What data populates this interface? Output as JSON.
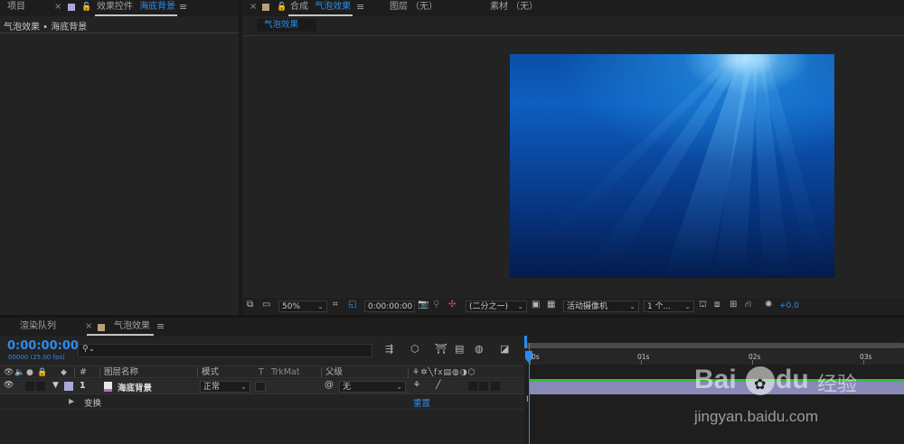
{
  "project_tab": {
    "label": "项目"
  },
  "effect_controls_tab": {
    "label": "效果控件",
    "layer": "海底背景"
  },
  "effect_controls": {
    "header": "气泡效果 • 海底背景"
  },
  "composition_tab": {
    "label": "合成",
    "name": "气泡效果"
  },
  "layer_tab": {
    "label": "图层 （无）"
  },
  "footage_tab": {
    "label": "素材 （无）"
  },
  "comp_subtab": {
    "label": "气泡效果"
  },
  "viewer_toolbar": {
    "zoom": "50%",
    "timecode": "0:00:00:00",
    "resolution": "(二分之一)",
    "camera": "活动摄像机",
    "views": "1 个...",
    "exposure": "+0.0"
  },
  "render_queue_tab": {
    "label": "渲染队列"
  },
  "timeline_tab": {
    "label": "气泡效果"
  },
  "timeline": {
    "current_time": "0:00:00:00",
    "frame_info": "00000 (25.00 fps)",
    "search_placeholder": "",
    "ruler": [
      "0s",
      "01s",
      "02s",
      "03s"
    ]
  },
  "columns": {
    "number": "#",
    "layer_name": "图层名称",
    "mode": "模式",
    "t": "T",
    "trkmat": "TrkMat",
    "parent": "父级"
  },
  "layers": [
    {
      "number": "1",
      "name": "海底背景",
      "mode": "正常",
      "parent": "无",
      "label_color": "#a9a9d6"
    }
  ],
  "transform": {
    "label": "变换",
    "reset": "重置"
  },
  "colors": {
    "accent_blue": "#2d8ceb",
    "track_green": "#2fbf3a",
    "layer_bar": "#8a8ab8",
    "comp_label": "#b8a07a",
    "project_label": "#a9a9d6"
  },
  "watermark": {
    "brand": "Baidu经验",
    "url": "jingyan.baidu.com"
  }
}
